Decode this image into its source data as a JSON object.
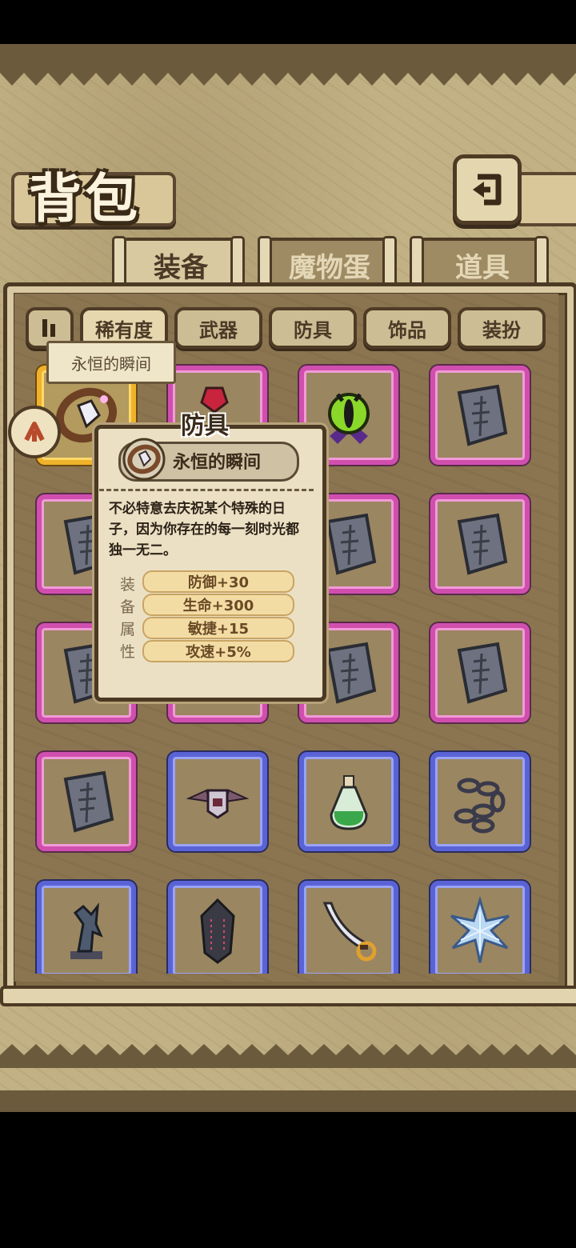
{
  "header": {
    "title": "背包"
  },
  "tabs": [
    {
      "label": "装备",
      "active": true
    },
    {
      "label": "魔物蛋",
      "active": false
    },
    {
      "label": "道具",
      "active": false
    }
  ],
  "filters": [
    {
      "label": "稀有度",
      "selected": true
    },
    {
      "label": "武器",
      "selected": false
    },
    {
      "label": "防具",
      "selected": false
    },
    {
      "label": "饰品",
      "selected": false
    },
    {
      "label": "装扮",
      "selected": false
    }
  ],
  "selected_item_tooltip": "永恒的瞬间",
  "item_grid": [
    {
      "rarity": "gold",
      "icon": "ring-icon"
    },
    {
      "rarity": "pink",
      "icon": "red-gem-icon"
    },
    {
      "rarity": "pink",
      "icon": "eye-icon"
    },
    {
      "rarity": "pink",
      "icon": "stone-tablet-icon"
    },
    {
      "rarity": "pink",
      "icon": "stone-tablet-icon"
    },
    {
      "rarity": "pink",
      "icon": "stone-tablet-icon"
    },
    {
      "rarity": "pink",
      "icon": "stone-tablet-icon"
    },
    {
      "rarity": "pink",
      "icon": "stone-tablet-icon"
    },
    {
      "rarity": "pink",
      "icon": "stone-tablet-icon"
    },
    {
      "rarity": "pink",
      "icon": "stone-tablet-icon"
    },
    {
      "rarity": "pink",
      "icon": "stone-tablet-icon"
    },
    {
      "rarity": "pink",
      "icon": "stone-tablet-icon"
    },
    {
      "rarity": "pink",
      "icon": "stone-tablet-icon"
    },
    {
      "rarity": "blue",
      "icon": "winged-helmet-icon"
    },
    {
      "rarity": "blue",
      "icon": "potion-icon"
    },
    {
      "rarity": "blue",
      "icon": "chain-icon"
    },
    {
      "rarity": "blue",
      "icon": "statue-icon"
    },
    {
      "rarity": "blue",
      "icon": "dark-crystal-icon"
    },
    {
      "rarity": "blue",
      "icon": "scimitar-icon"
    },
    {
      "rarity": "blue",
      "icon": "ice-shard-icon"
    }
  ],
  "item_popup": {
    "category": "防具",
    "name": "永恒的瞬间",
    "description": "不必特意去庆祝某个特殊的日子，因为你存在的每一刻时光都独一无二。",
    "attribute_label": [
      "装",
      "备",
      "属",
      "性"
    ],
    "attributes": [
      "防御+30",
      "生命+300",
      "敏捷+15",
      "攻速+5%"
    ]
  },
  "colors": {
    "rarity_gold": "#f0b22a",
    "rarity_pink": "#d04fae",
    "rarity_blue": "#5a63d6",
    "frame_brown": "#4e3b26",
    "parchment": "#ebe0c3"
  }
}
